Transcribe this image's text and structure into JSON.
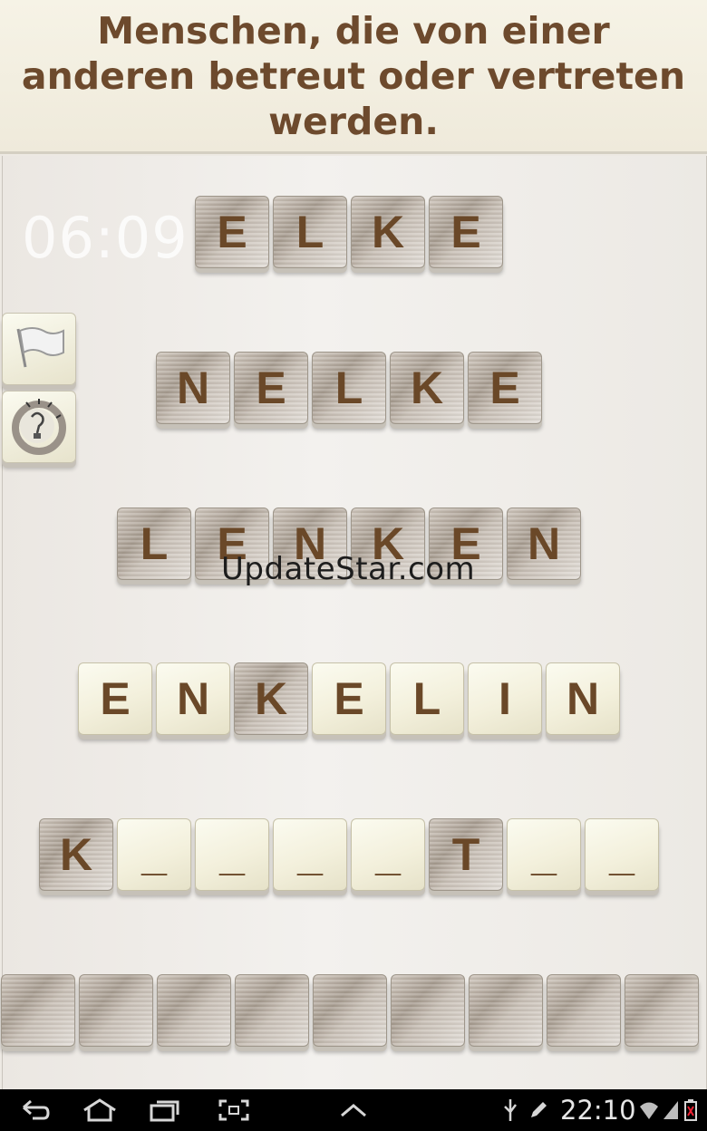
{
  "clue": "Menschen, die von einer anderen betreut oder vertreten werden.",
  "timer": "06:09",
  "rows": [
    {
      "tiles": [
        {
          "letter": "E",
          "style": "wood"
        },
        {
          "letter": "L",
          "style": "wood"
        },
        {
          "letter": "K",
          "style": "wood"
        },
        {
          "letter": "E",
          "style": "wood"
        }
      ]
    },
    {
      "tiles": [
        {
          "letter": "N",
          "style": "wood"
        },
        {
          "letter": "E",
          "style": "wood"
        },
        {
          "letter": "L",
          "style": "wood"
        },
        {
          "letter": "K",
          "style": "wood"
        },
        {
          "letter": "E",
          "style": "wood"
        }
      ]
    },
    {
      "tiles": [
        {
          "letter": "L",
          "style": "wood"
        },
        {
          "letter": "E",
          "style": "wood"
        },
        {
          "letter": "N",
          "style": "wood"
        },
        {
          "letter": "K",
          "style": "wood"
        },
        {
          "letter": "E",
          "style": "wood"
        },
        {
          "letter": "N",
          "style": "wood"
        }
      ]
    },
    {
      "tiles": [
        {
          "letter": "E",
          "style": "cream"
        },
        {
          "letter": "N",
          "style": "cream"
        },
        {
          "letter": "K",
          "style": "wood"
        },
        {
          "letter": "E",
          "style": "cream"
        },
        {
          "letter": "L",
          "style": "cream"
        },
        {
          "letter": "I",
          "style": "cream"
        },
        {
          "letter": "N",
          "style": "cream"
        }
      ]
    },
    {
      "tiles": [
        {
          "letter": "K",
          "style": "wood"
        },
        {
          "letter": "_",
          "style": "cream"
        },
        {
          "letter": "_",
          "style": "cream"
        },
        {
          "letter": "_",
          "style": "cream"
        },
        {
          "letter": "_",
          "style": "cream"
        },
        {
          "letter": "T",
          "style": "wood"
        },
        {
          "letter": "_",
          "style": "cream"
        },
        {
          "letter": "_",
          "style": "cream"
        }
      ]
    },
    {
      "tiles": [
        {
          "letter": "",
          "style": "wood"
        },
        {
          "letter": "",
          "style": "wood"
        },
        {
          "letter": "",
          "style": "wood"
        },
        {
          "letter": "",
          "style": "wood"
        },
        {
          "letter": "",
          "style": "wood"
        },
        {
          "letter": "",
          "style": "wood"
        },
        {
          "letter": "",
          "style": "wood"
        },
        {
          "letter": "",
          "style": "wood"
        },
        {
          "letter": "",
          "style": "wood"
        }
      ]
    }
  ],
  "side_buttons": [
    {
      "icon": "flag-icon"
    },
    {
      "icon": "lightbulb-icon"
    }
  ],
  "watermark": "UpdateStar.com",
  "statusbar": {
    "time": "22:10",
    "icons": [
      "back-icon",
      "home-icon",
      "recent-apps-icon",
      "screenshot-icon",
      "up-chevron-icon",
      "usb-icon",
      "edit-icon",
      "wifi-icon",
      "signal-icon",
      "battery-icon"
    ]
  }
}
